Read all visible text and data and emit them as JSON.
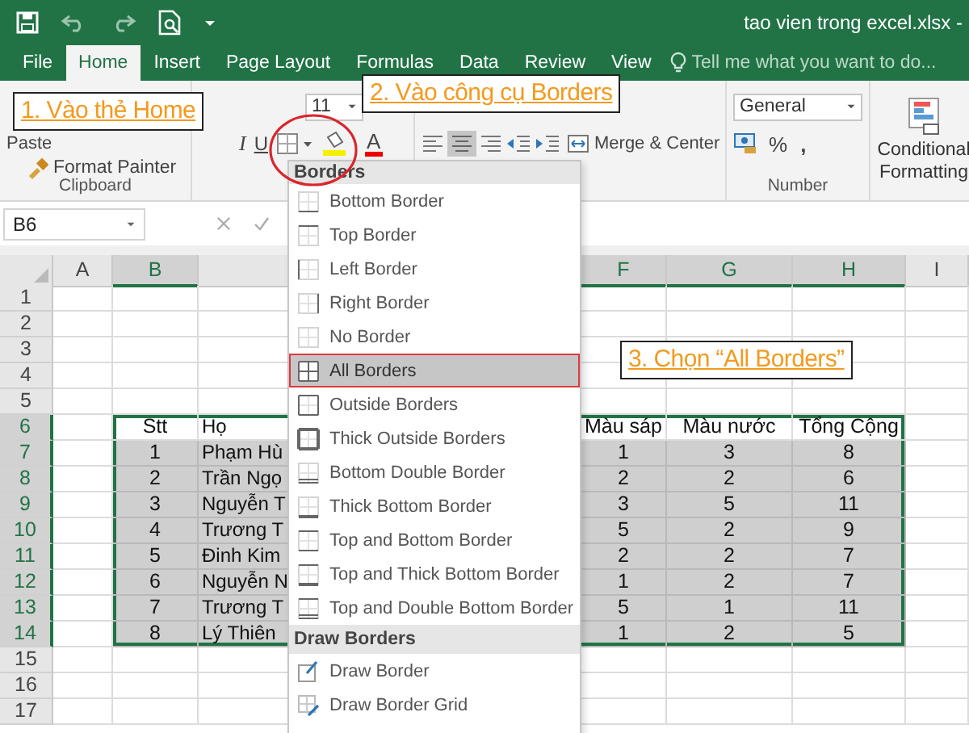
{
  "window": {
    "title": "tao vien trong excel.xlsx -"
  },
  "tabs": [
    {
      "label": "File",
      "selected": false
    },
    {
      "label": "Home",
      "selected": true
    },
    {
      "label": "Insert",
      "selected": false
    },
    {
      "label": "Page Layout",
      "selected": false
    },
    {
      "label": "Formulas",
      "selected": false
    },
    {
      "label": "Data",
      "selected": false
    },
    {
      "label": "Review",
      "selected": false
    },
    {
      "label": "View",
      "selected": false
    }
  ],
  "tell_me": {
    "placeholder": "Tell me what you want to do..."
  },
  "ribbon": {
    "clipboard": {
      "paste": "Paste",
      "format_painter": "Format Painter",
      "label": "Clipboard"
    },
    "font": {
      "size": "11",
      "italic": "I",
      "underline": "U",
      "font_color_button": "A"
    },
    "alignment": {
      "merge": "Merge & Center"
    },
    "number": {
      "format": "General",
      "percent": "%",
      "comma": ",",
      "label": "Number"
    },
    "styles": {
      "conditional": "Conditional Formatting"
    }
  },
  "formula_bar": {
    "name_box": "B6"
  },
  "sheet": {
    "columns": [
      {
        "letter": "A",
        "selected": false
      },
      {
        "letter": "B",
        "selected": true
      },
      {
        "letter": "F",
        "selected": true
      },
      {
        "letter": "G",
        "selected": true
      },
      {
        "letter": "H",
        "selected": true
      },
      {
        "letter": "I",
        "selected": false
      }
    ],
    "rows": [
      {
        "label": "1",
        "selected": false
      },
      {
        "label": "2",
        "selected": false
      },
      {
        "label": "3",
        "selected": false
      },
      {
        "label": "4",
        "selected": false
      },
      {
        "label": "5",
        "selected": false
      },
      {
        "label": "6",
        "selected": true,
        "shaded": false,
        "cells": [
          "Stt",
          "Họ",
          "Màu sáp",
          "Màu nước",
          "Tổng Cộng"
        ]
      },
      {
        "label": "7",
        "selected": true,
        "shaded": true,
        "cells": [
          "1",
          "Phạm Hù",
          "1",
          "3",
          "8"
        ]
      },
      {
        "label": "8",
        "selected": true,
        "shaded": true,
        "cells": [
          "2",
          "Trần Ngọ",
          "2",
          "2",
          "6"
        ]
      },
      {
        "label": "9",
        "selected": true,
        "shaded": true,
        "cells": [
          "3",
          "Nguyễn T",
          "3",
          "5",
          "11"
        ]
      },
      {
        "label": "10",
        "selected": true,
        "shaded": true,
        "cells": [
          "4",
          "Trương T",
          "5",
          "2",
          "9"
        ]
      },
      {
        "label": "11",
        "selected": true,
        "shaded": true,
        "cells": [
          "5",
          "Đinh Kim",
          "2",
          "2",
          "7"
        ]
      },
      {
        "label": "12",
        "selected": true,
        "shaded": true,
        "cells": [
          "6",
          "Nguyễn N",
          "1",
          "2",
          "7"
        ]
      },
      {
        "label": "13",
        "selected": true,
        "shaded": true,
        "cells": [
          "7",
          "Trương T",
          "5",
          "1",
          "11"
        ]
      },
      {
        "label": "14",
        "selected": true,
        "shaded": true,
        "cells": [
          "8",
          "Lý Thiên",
          "1",
          "2",
          "5"
        ]
      },
      {
        "label": "15",
        "selected": false
      },
      {
        "label": "16",
        "selected": false
      },
      {
        "label": "17",
        "selected": false
      }
    ]
  },
  "menu": {
    "title": "Borders",
    "items": [
      {
        "label": "Bottom Border",
        "kind": "bottom",
        "selected": false
      },
      {
        "label": "Top Border",
        "kind": "top",
        "selected": false
      },
      {
        "label": "Left Border",
        "kind": "left",
        "selected": false
      },
      {
        "label": "Right Border",
        "kind": "right",
        "selected": false
      },
      {
        "label": "No Border",
        "kind": "none",
        "selected": false
      },
      {
        "label": "All Borders",
        "kind": "all",
        "selected": true
      },
      {
        "label": "Outside Borders",
        "kind": "outside",
        "selected": false
      },
      {
        "label": "Thick Outside Borders",
        "kind": "thick-outside",
        "selected": false
      },
      {
        "label": "Bottom Double Border",
        "kind": "bottom-double",
        "selected": false
      },
      {
        "label": "Thick Bottom Border",
        "kind": "thick-bottom",
        "selected": false
      },
      {
        "label": "Top and Bottom Border",
        "kind": "top-bottom",
        "selected": false
      },
      {
        "label": "Top and Thick Bottom Border",
        "kind": "top-thick-bottom",
        "selected": false
      },
      {
        "label": "Top and Double Bottom Border",
        "kind": "top-double-bottom",
        "selected": false
      }
    ],
    "section": "Draw Borders",
    "draw_items": [
      {
        "label": "Draw Border",
        "kind": "draw"
      },
      {
        "label": "Draw Border Grid",
        "kind": "grid"
      }
    ]
  },
  "callouts": [
    {
      "text": "1. Vào thẻ Home"
    },
    {
      "text": "2. Vào công cụ Borders"
    },
    {
      "text": "3. Chọn “All Borders”"
    }
  ]
}
